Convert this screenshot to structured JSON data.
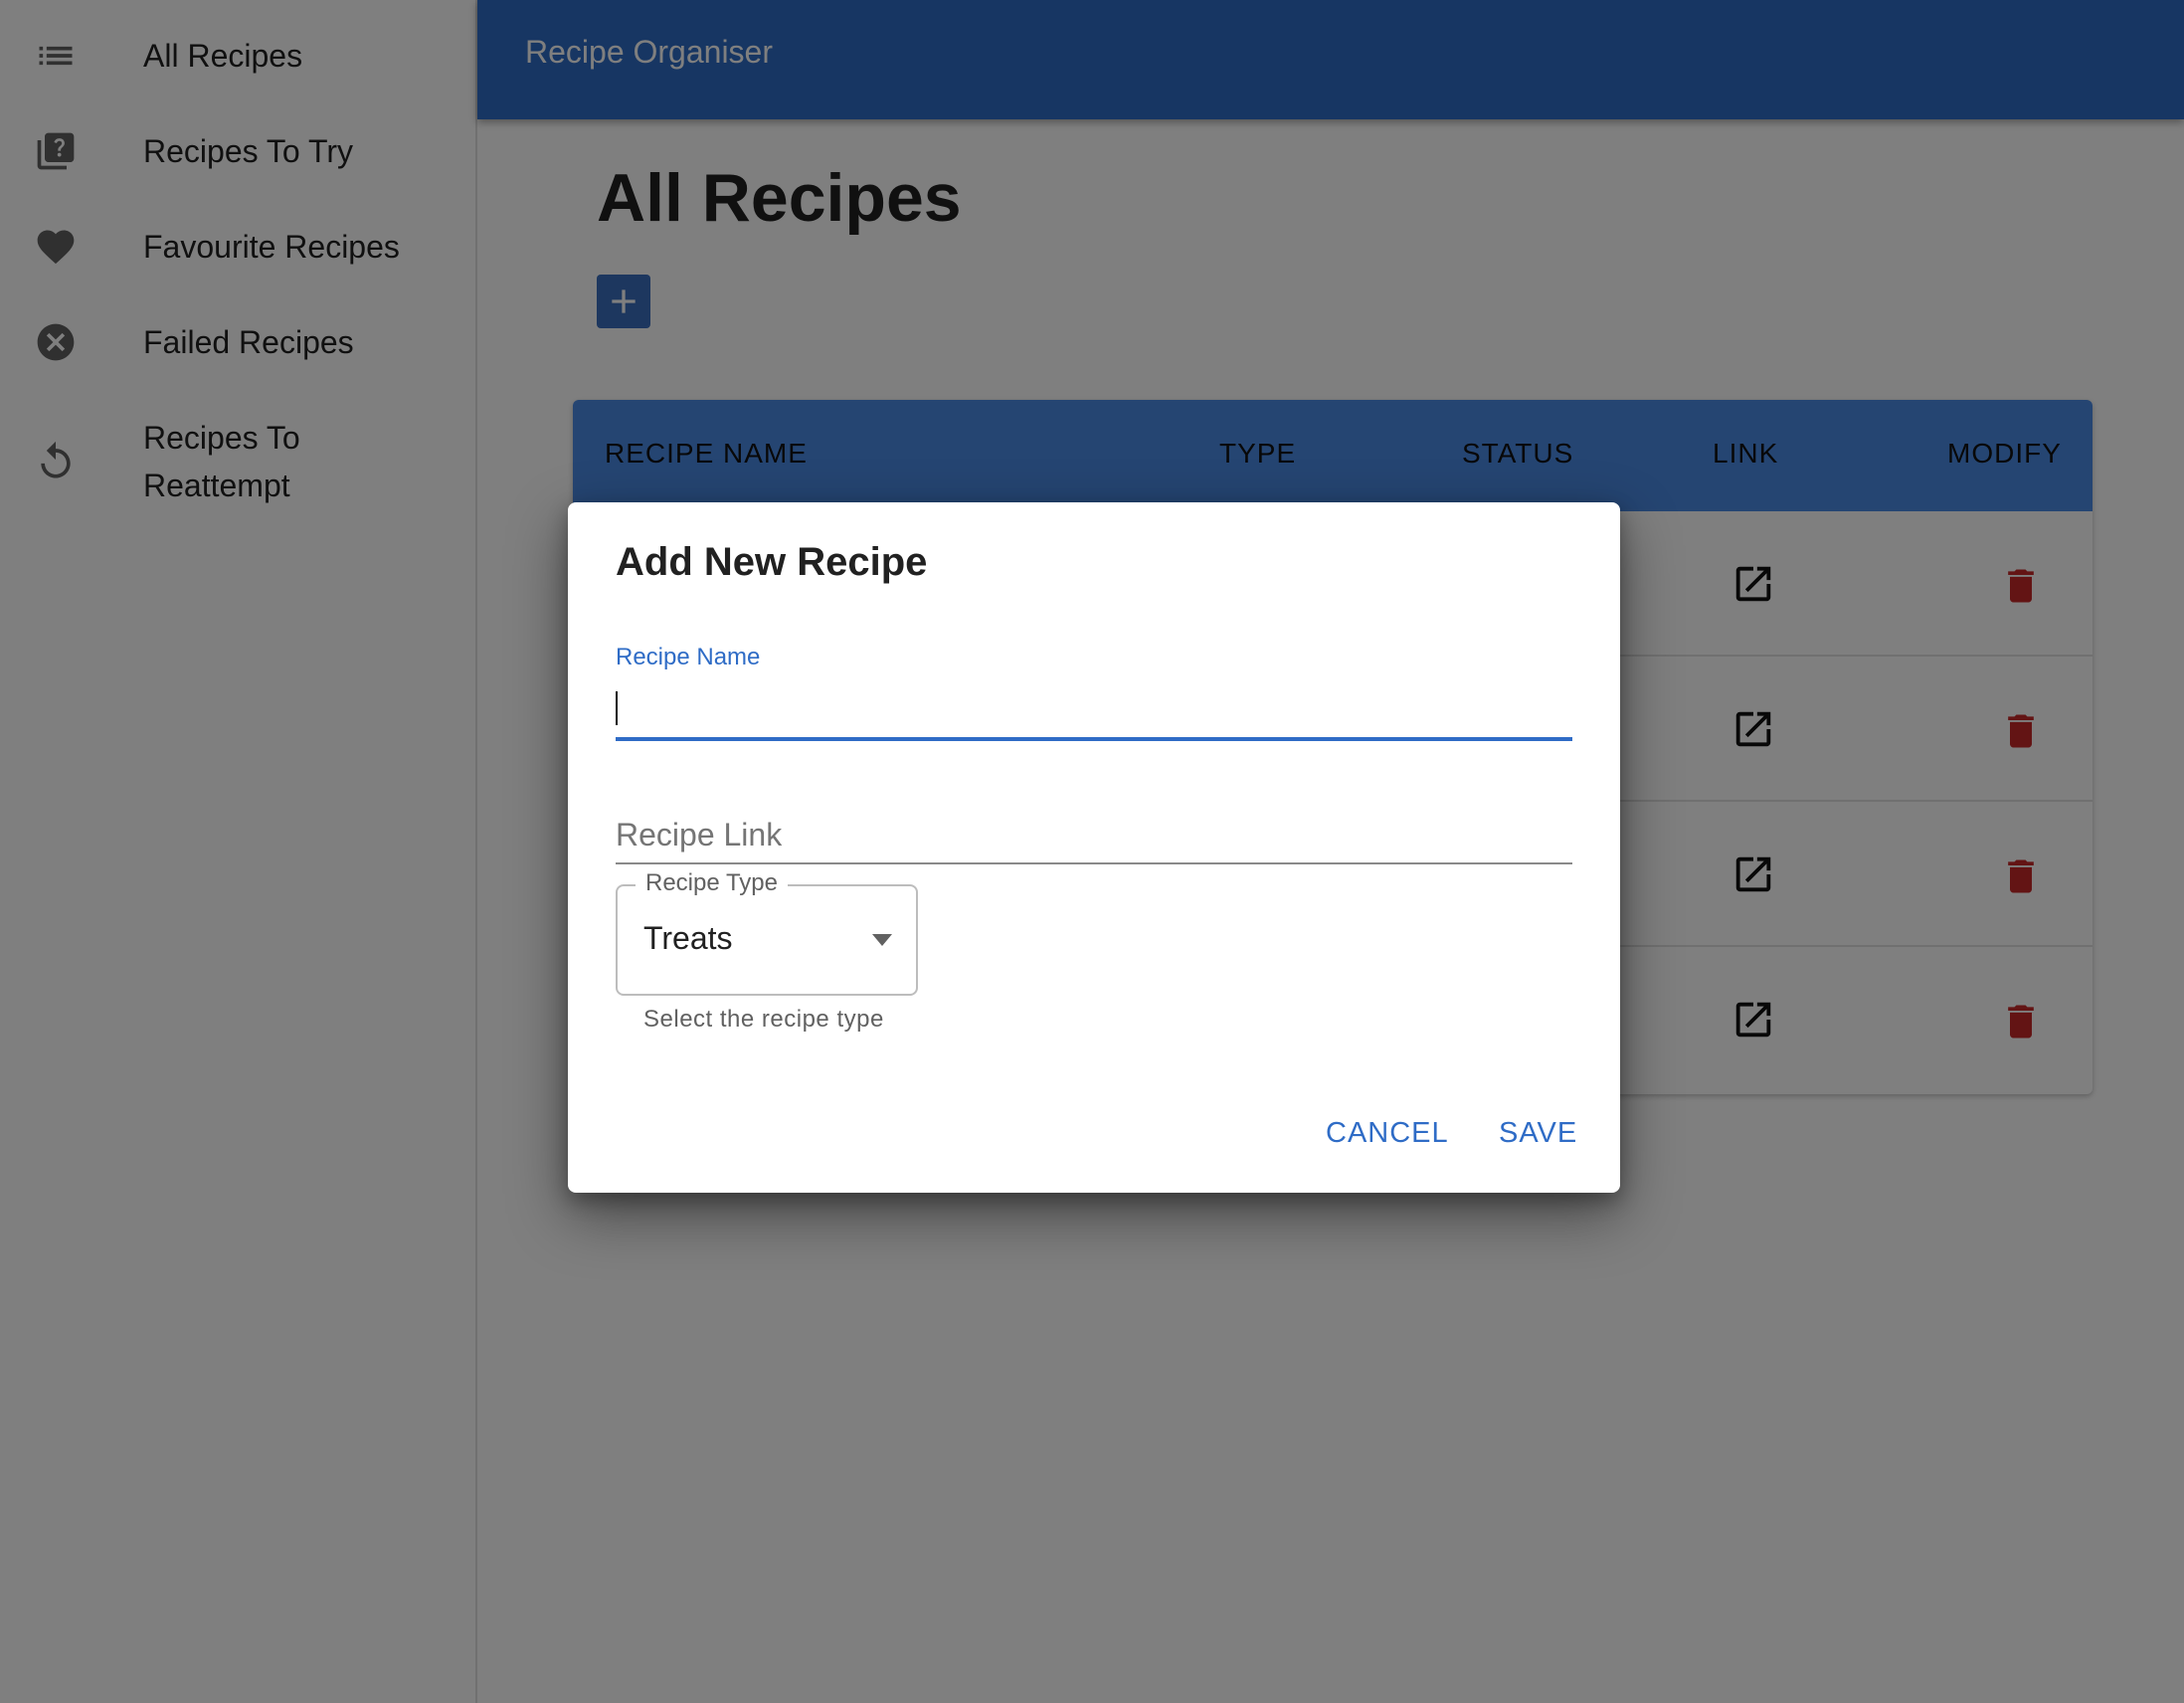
{
  "sidebar": {
    "items": [
      {
        "label": "All Recipes",
        "icon": "list-icon"
      },
      {
        "label": "Recipes To Try",
        "icon": "question-library-icon"
      },
      {
        "label": "Favourite Recipes",
        "icon": "heart-icon"
      },
      {
        "label": "Failed Recipes",
        "icon": "cancel-circle-icon"
      },
      {
        "label": "Recipes To Reattempt",
        "icon": "replay-icon"
      }
    ]
  },
  "header": {
    "title": "Recipe Organiser"
  },
  "main": {
    "title": "All Recipes",
    "add_icon": "plus-icon"
  },
  "table": {
    "columns": [
      "RECIPE NAME",
      "TYPE",
      "STATUS",
      "LINK",
      "MODIFY"
    ],
    "row_count": 4
  },
  "dialog": {
    "title": "Add New Recipe",
    "name_label": "Recipe Name",
    "name_value": "",
    "link_placeholder": "Recipe Link",
    "type_label": "Recipe Type",
    "type_value": "Treats",
    "type_helper": "Select the recipe type",
    "cancel_label": "CANCEL",
    "save_label": "SAVE"
  },
  "colors": {
    "appbar": "#2f6cc6",
    "table_header": "#4a8ae4",
    "accent": "#2f6cc6",
    "delete": "#c62828"
  }
}
